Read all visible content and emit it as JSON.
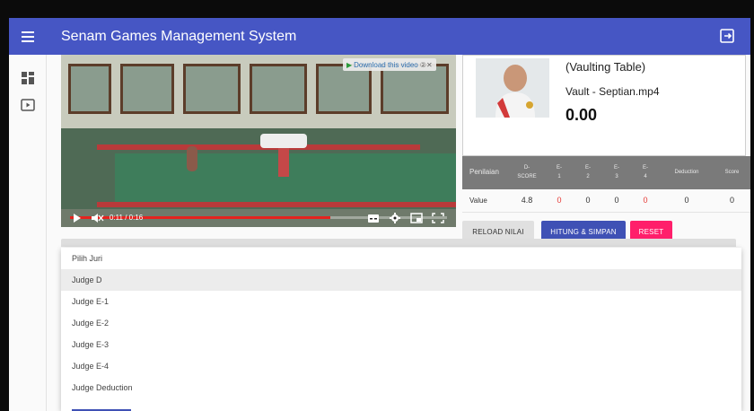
{
  "app": {
    "title": "Senam Games Management System"
  },
  "video": {
    "download_label": "Download this video",
    "time": "0:11 / 0:16",
    "progress": 0.69
  },
  "info": {
    "apparatus": "(Vaulting Table)",
    "file": "Vault - Septian.mp4",
    "score": "0.00"
  },
  "score_table": {
    "headers": [
      [
        "Penilaian"
      ],
      [
        "D-",
        "SCORE"
      ],
      [
        "E-",
        "1"
      ],
      [
        "E-",
        "2"
      ],
      [
        "E-",
        "3"
      ],
      [
        "E-",
        "4"
      ],
      [
        "Deduction"
      ],
      [
        "Score"
      ]
    ],
    "row": {
      "label": "Value",
      "cells": [
        "4.8",
        "0",
        "0",
        "0",
        "0",
        "0",
        "0"
      ]
    }
  },
  "buttons": {
    "reload": "RELOAD NILAI",
    "hitung": "HITUNG & SIMPAN",
    "reset": "RESET"
  },
  "dropdown": {
    "options": [
      "Pilih Juri",
      "Judge D",
      "Judge E-1",
      "Judge E-2",
      "Judge E-3",
      "Judge E-4",
      "Judge Deduction"
    ],
    "highlighted": "Judge D"
  },
  "colors": {
    "appbar": "#4656c4",
    "primary_button": "#3f51b5",
    "reset_button": "#ff1f6b",
    "zero_red": "#e53935"
  }
}
